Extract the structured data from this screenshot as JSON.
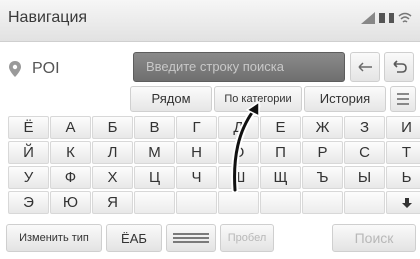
{
  "window": {
    "title": "Навигация"
  },
  "search": {
    "category": "POI",
    "placeholder": "Введите строку поиска"
  },
  "tabs": [
    {
      "label": "Рядом"
    },
    {
      "label": "По категории"
    },
    {
      "label": "История"
    }
  ],
  "keyboard": {
    "rows": [
      [
        "Ё",
        "А",
        "Б",
        "В",
        "Г",
        "Д",
        "Е",
        "Ж",
        "З",
        "И"
      ],
      [
        "Й",
        "К",
        "Л",
        "М",
        "Н",
        "О",
        "П",
        "Р",
        "С",
        "Т"
      ],
      [
        "У",
        "Ф",
        "Х",
        "Ц",
        "Ч",
        "Ш",
        "Щ",
        "Ъ",
        "Ы",
        "Ь"
      ],
      [
        "Э",
        "Ю",
        "Я",
        "",
        "",
        "",
        "",
        "",
        "",
        ""
      ]
    ]
  },
  "bottom": {
    "change_type": "Изменить тип",
    "layout": "ЁАБ",
    "space": "Пробел",
    "search": "Поиск"
  },
  "icons": {
    "pin": "location-pin-icon",
    "backspace": "backspace-icon",
    "undo": "undo-icon",
    "menu": "list-menu-icon",
    "down": "scroll-down-icon",
    "lines": "line-format-icon"
  }
}
